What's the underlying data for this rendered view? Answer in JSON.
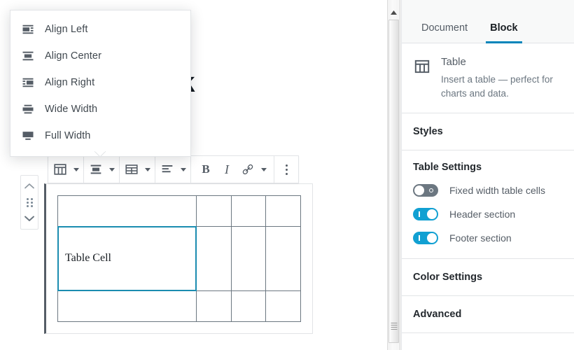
{
  "editor": {
    "post_heading": "Table Block",
    "block_mover": {
      "move_up_icon": "chevron-up-icon",
      "drag_handle_icon": "drag-handle-icon",
      "move_down_icon": "chevron-down-icon"
    },
    "toolbar": {
      "groups": [
        {
          "buttons": [
            {
              "name": "change-block-type",
              "icon": "table-icon",
              "label": "Table",
              "has_caret": true
            }
          ]
        },
        {
          "buttons": [
            {
              "name": "change-alignment",
              "icon": "align-center-icon",
              "label": "Change alignment",
              "has_caret": true,
              "active": true
            }
          ]
        },
        {
          "buttons": [
            {
              "name": "edit-table",
              "icon": "edit-table-icon",
              "label": "Edit table",
              "has_caret": true
            }
          ]
        },
        {
          "buttons": [
            {
              "name": "change-text-alignment",
              "icon": "text-align-left-icon",
              "label": "Change text alignment",
              "has_caret": true
            }
          ]
        },
        {
          "buttons": [
            {
              "name": "bold",
              "icon": "bold-icon",
              "label": "B",
              "has_caret": false
            },
            {
              "name": "italic",
              "icon": "italic-icon",
              "label": "I",
              "has_caret": false
            },
            {
              "name": "link",
              "icon": "link-icon",
              "label": "Link",
              "has_caret": false
            },
            {
              "name": "more-rich-text",
              "icon": "caret-down-icon",
              "label": "More rich text controls",
              "has_caret": false,
              "caret_only": true
            }
          ]
        },
        {
          "buttons": [
            {
              "name": "more-options",
              "icon": "kebab-menu-icon",
              "label": "More options",
              "has_caret": false
            }
          ]
        }
      ]
    },
    "align_dropdown": {
      "items": [
        {
          "icon": "align-left-icon",
          "label": "Align Left"
        },
        {
          "icon": "align-center-icon",
          "label": "Align Center"
        },
        {
          "icon": "align-right-icon",
          "label": "Align Right"
        },
        {
          "icon": "wide-width-icon",
          "label": "Wide Width"
        },
        {
          "icon": "full-width-icon",
          "label": "Full Width"
        }
      ]
    },
    "table": {
      "columns": 4,
      "rows": [
        [
          "",
          "",
          "",
          ""
        ],
        [
          "Table Cell",
          "",
          "",
          ""
        ],
        [
          "",
          "",
          "",
          ""
        ]
      ],
      "selected_cell": {
        "row": 1,
        "col": 0
      },
      "selected_border_color": "#1b8cb0"
    },
    "scrollbar": {
      "up_arrow_icon": "scroll-up-arrow-icon",
      "grip_icon": "scrollbar-grip-icon"
    }
  },
  "sidebar": {
    "tabs": [
      {
        "name": "document",
        "label": "Document",
        "active": false
      },
      {
        "name": "block",
        "label": "Block",
        "active": true
      }
    ],
    "active_tab_accent": "#0085ba",
    "block_card": {
      "icon": "table-icon",
      "title": "Table",
      "description": "Insert a table — perfect for charts and data."
    },
    "panels": [
      {
        "name": "styles",
        "title": "Styles"
      }
    ],
    "table_settings": {
      "title": "Table Settings",
      "toggles": [
        {
          "name": "fixed-width-table-cells",
          "label": "Fixed width table cells",
          "on": false
        },
        {
          "name": "header-section",
          "label": "Header section",
          "on": true
        },
        {
          "name": "footer-section",
          "label": "Footer section",
          "on": true
        }
      ],
      "toggle_on_color": "#11a0d2",
      "toggle_off_color": "#6c7781"
    },
    "bottom_panels": [
      {
        "name": "color-settings",
        "title": "Color Settings"
      },
      {
        "name": "advanced",
        "title": "Advanced"
      }
    ]
  }
}
